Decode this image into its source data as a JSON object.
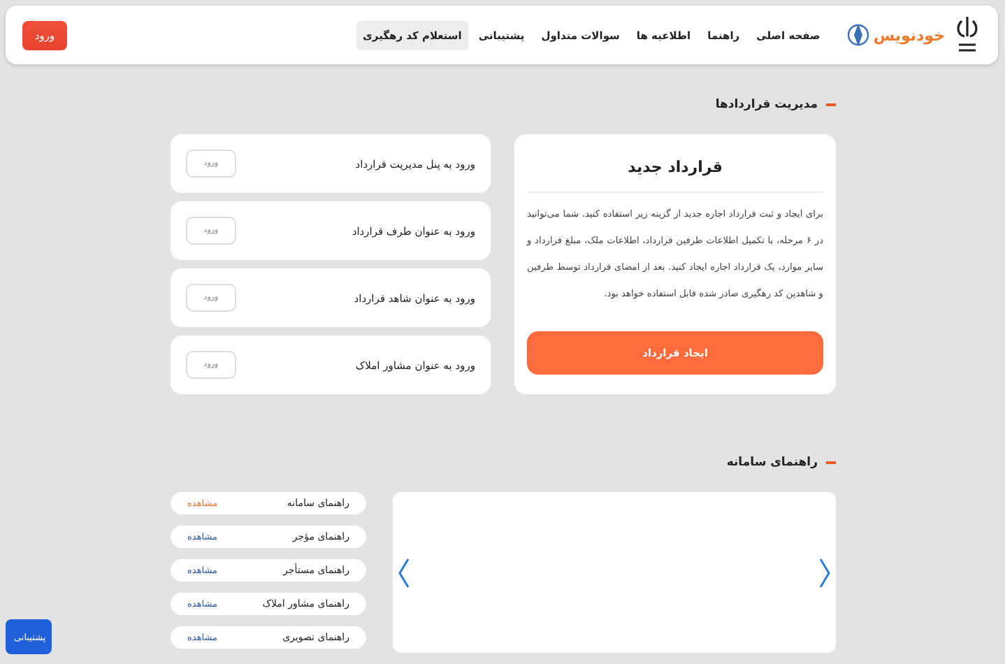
{
  "header": {
    "brand": "خودنویس",
    "nav": [
      {
        "label": "صفحه اصلی",
        "selected": false
      },
      {
        "label": "راهنما",
        "selected": false
      },
      {
        "label": "اطلاعیه ها",
        "selected": false
      },
      {
        "label": "سوالات متداول",
        "selected": false
      },
      {
        "label": "پشتیبانی",
        "selected": false
      },
      {
        "label": "استعلام کد رهگیری",
        "selected": true
      }
    ],
    "login_button": "ورود"
  },
  "contracts": {
    "title": "مدیریت قراردادها",
    "new_contract": {
      "title": "قرارداد جدید",
      "description": "برای ایجاد و ثبت قرارداد اجاره جدید از گزینه زیر استفاده کنید. شما می‌توانید در ۶ مرحله، با تکمیل اطلاعات طرفین قرارداد، اطلاعات ملک، مبلغ قرارداد و سایر موارد، یک قرارداد اجاره ایجاد کنید. بعد از امضای قرارداد توسط طرفین و شاهدین کد رهگیری صادر شده قابل استفاده خواهد بود.",
      "button": "ایجاد قرارداد"
    },
    "logins": [
      {
        "label": "ورود به پنل مدیریت قرارداد",
        "button": "ورود"
      },
      {
        "label": "ورود به عنوان طرف قرارداد",
        "button": "ورود"
      },
      {
        "label": "ورود به عنوان شاهد قرارداد",
        "button": "ورود"
      },
      {
        "label": "ورود به عنوان مشاور املاک",
        "button": "ورود"
      }
    ]
  },
  "guides": {
    "title": "راهنمای سامانه",
    "items": [
      {
        "label": "راهنمای سامانه",
        "link": "مشاهده",
        "selected": true
      },
      {
        "label": "راهنمای مؤجر",
        "link": "مشاهده",
        "selected": false
      },
      {
        "label": "راهنمای مستأجر",
        "link": "مشاهده",
        "selected": false
      },
      {
        "label": "راهنمای مشاور املاک",
        "link": "مشاهده",
        "selected": false
      },
      {
        "label": "راهنمای تصویری",
        "link": "مشاهده",
        "selected": false
      }
    ]
  },
  "support_button": "پشتیبانی"
}
